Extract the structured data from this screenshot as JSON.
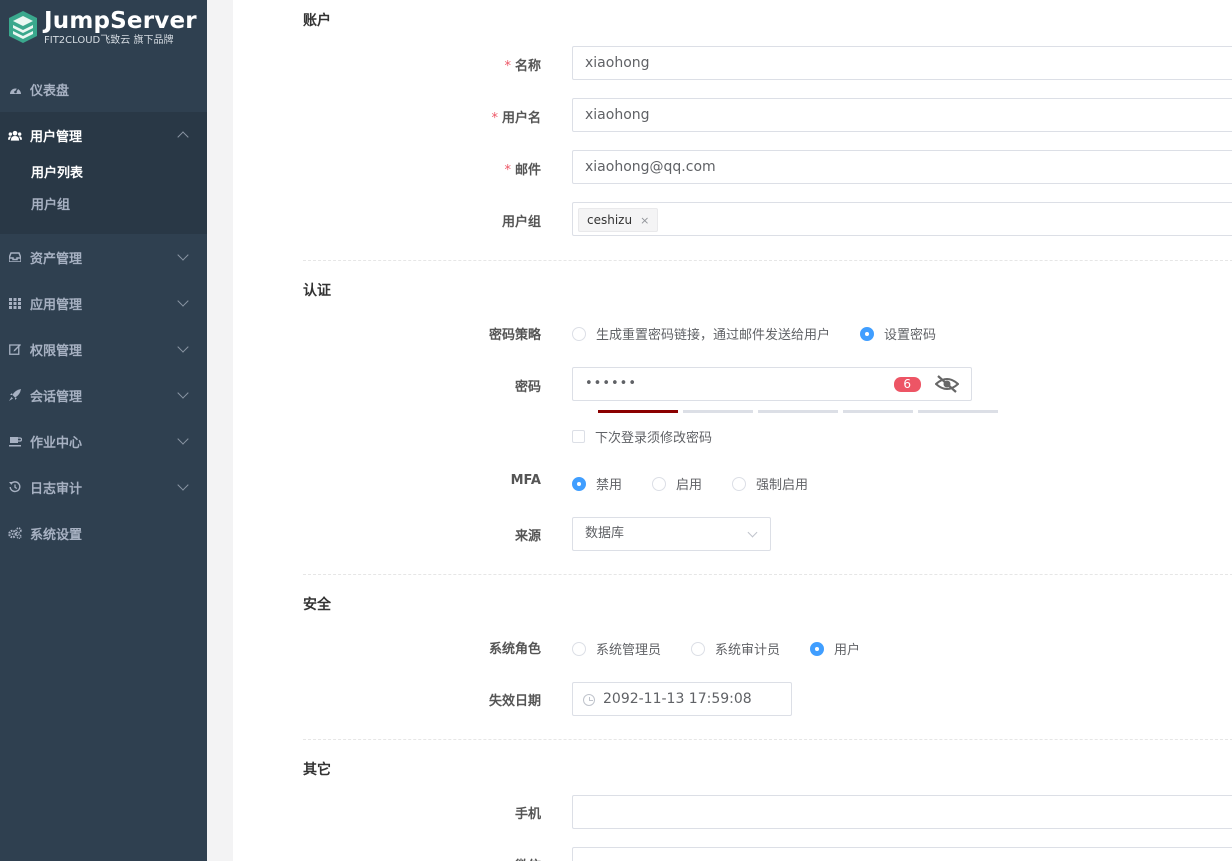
{
  "brand": {
    "title": "JumpServer",
    "subtitle": "FIT2CLOUD飞致云 旗下品牌"
  },
  "sidebar": {
    "items": [
      {
        "label": "仪表盘",
        "icon": "dashboard-icon"
      },
      {
        "label": "用户管理",
        "icon": "users-icon",
        "expanded": true,
        "children": [
          {
            "label": "用户列表",
            "active": true
          },
          {
            "label": "用户组"
          }
        ]
      },
      {
        "label": "资产管理",
        "icon": "inbox-icon"
      },
      {
        "label": "应用管理",
        "icon": "grid-icon"
      },
      {
        "label": "权限管理",
        "icon": "edit-icon"
      },
      {
        "label": "会话管理",
        "icon": "rocket-icon"
      },
      {
        "label": "作业中心",
        "icon": "coffee-icon"
      },
      {
        "label": "日志审计",
        "icon": "history-icon"
      },
      {
        "label": "系统设置",
        "icon": "gears-icon"
      }
    ]
  },
  "form": {
    "sections": {
      "account": "账户",
      "auth": "认证",
      "security": "安全",
      "other": "其它"
    },
    "required_mark": "*",
    "name": {
      "label": "名称",
      "value": "xiaohong"
    },
    "username": {
      "label": "用户名",
      "value": "xiaohong"
    },
    "email": {
      "label": "邮件",
      "value": "xiaohong@qq.com"
    },
    "group": {
      "label": "用户组",
      "tags": [
        "ceshizu"
      ],
      "remove": "×"
    },
    "password_strategy": {
      "label": "密码策略",
      "options": [
        "生成重置密码链接，通过邮件发送给用户",
        "设置密码"
      ],
      "selected": 1
    },
    "password": {
      "label": "密码",
      "value": "••••••",
      "length_badge": "6",
      "strength_level": 1,
      "strength_max": 5
    },
    "must_change": {
      "label": "下次登录须修改密码",
      "checked": false
    },
    "mfa": {
      "label": "MFA",
      "options": [
        "禁用",
        "启用",
        "强制启用"
      ],
      "selected": 0
    },
    "source": {
      "label": "来源",
      "value": "数据库"
    },
    "role": {
      "label": "系统角色",
      "options": [
        "系统管理员",
        "系统审计员",
        "用户"
      ],
      "selected": 2
    },
    "expire": {
      "label": "失效日期",
      "value": "2092-11-13 17:59:08"
    },
    "phone": {
      "label": "手机",
      "value": ""
    },
    "wechat": {
      "label": "微信",
      "value": ""
    }
  },
  "colors": {
    "sidebar_bg": "#2f4050",
    "sidebar_active_bg": "#293846",
    "accent": "#409eff",
    "danger": "#ed5565",
    "strength_weak": "#8b0000"
  }
}
